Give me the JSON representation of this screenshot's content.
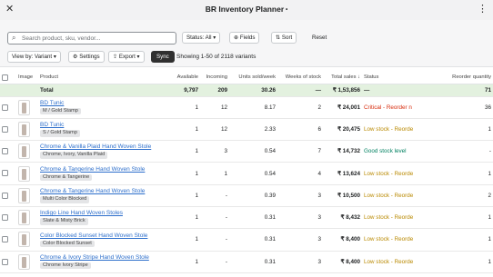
{
  "window": {
    "title": "BR Inventory Planner",
    "title_dot": "•",
    "close_icon": "close-icon",
    "more_icon": "more-dots-icon"
  },
  "toolbar": {
    "search_placeholder": "Search product, sku, vendor...",
    "status_filter": "Status: All",
    "fields_label": "Fields",
    "sort_label": "Sort",
    "reset_label": "Reset",
    "view_label": "View by: Variant",
    "settings_label": "Settings",
    "export_label": "Export",
    "sync_label": "Sync",
    "showing_text": "Showing 1-50 of 2118 variants"
  },
  "columns": {
    "image": "Image",
    "product": "Product",
    "available": "Available",
    "incoming": "Incoming",
    "units_sold_week": "Units sold/week",
    "weeks_of_stock": "Weeks of stock",
    "total_sales": "Total sales",
    "sort_arrow": "↓",
    "status": "Status",
    "reorder_quantity": "Reorder quantity"
  },
  "total_row": {
    "label": "Total",
    "available": "9,797",
    "incoming": "209",
    "units_sold_week": "30.26",
    "weeks_of_stock": "—",
    "total_sales": "₹ 1,53,856",
    "status": "—",
    "reorder_quantity": "71"
  },
  "rows": [
    {
      "product": "BD Tunic",
      "variant": "M / Gold Stamp",
      "available": "1",
      "incoming": "12",
      "units_sold_week": "8.17",
      "weeks_of_stock": "2",
      "total_sales": "₹ 24,001",
      "status": "Critical - Reorder n",
      "status_type": "critical",
      "reorder_quantity": "36"
    },
    {
      "product": "BD Tunic",
      "variant": "S / Gold Stamp",
      "available": "1",
      "incoming": "12",
      "units_sold_week": "2.33",
      "weeks_of_stock": "6",
      "total_sales": "₹ 20,475",
      "status": "Low stock - Reorde",
      "status_type": "low",
      "reorder_quantity": "1"
    },
    {
      "product": "Chrome & Vanilla Plaid Hand Woven Stole",
      "variant": "Chrome, Ivory, Vanilla Plaid",
      "available": "1",
      "incoming": "3",
      "units_sold_week": "0.54",
      "weeks_of_stock": "7",
      "total_sales": "₹ 14,732",
      "status": "Good stock level",
      "status_type": "good",
      "reorder_quantity": "-"
    },
    {
      "product": "Chrome & Tangerine Hand Woven Stole",
      "variant": "Chrome & Tangerine",
      "available": "1",
      "incoming": "1",
      "units_sold_week": "0.54",
      "weeks_of_stock": "4",
      "total_sales": "₹ 13,624",
      "status": "Low stock - Reorde",
      "status_type": "low",
      "reorder_quantity": "1"
    },
    {
      "product": "Chrome & Tangerine Hand Woven Stole",
      "variant": "Multi Color Blocked",
      "available": "1",
      "incoming": "-",
      "units_sold_week": "0.39",
      "weeks_of_stock": "3",
      "total_sales": "₹ 10,500",
      "status": "Low stock - Reorde",
      "status_type": "low",
      "reorder_quantity": "2"
    },
    {
      "product": "Indigo Line Hand Woven Stoles",
      "variant": "Slate & Misty Brick",
      "available": "1",
      "incoming": "-",
      "units_sold_week": "0.31",
      "weeks_of_stock": "3",
      "total_sales": "₹ 8,432",
      "status": "Low stock - Reorde",
      "status_type": "low",
      "reorder_quantity": "1"
    },
    {
      "product": "Color Blocked Sunset Hand Woven Stole",
      "variant": "Color Blocked Sunset",
      "available": "1",
      "incoming": "-",
      "units_sold_week": "0.31",
      "weeks_of_stock": "3",
      "total_sales": "₹ 8,400",
      "status": "Low stock - Reorde",
      "status_type": "low",
      "reorder_quantity": "1"
    },
    {
      "product": "Chrome & Ivory Stripe Hand Woven Stole",
      "variant": "Chrome Ivory Stripe",
      "available": "1",
      "incoming": "-",
      "units_sold_week": "0.31",
      "weeks_of_stock": "3",
      "total_sales": "₹ 8,400",
      "status": "Low stock - Reorde",
      "status_type": "low",
      "reorder_quantity": "1"
    }
  ]
}
